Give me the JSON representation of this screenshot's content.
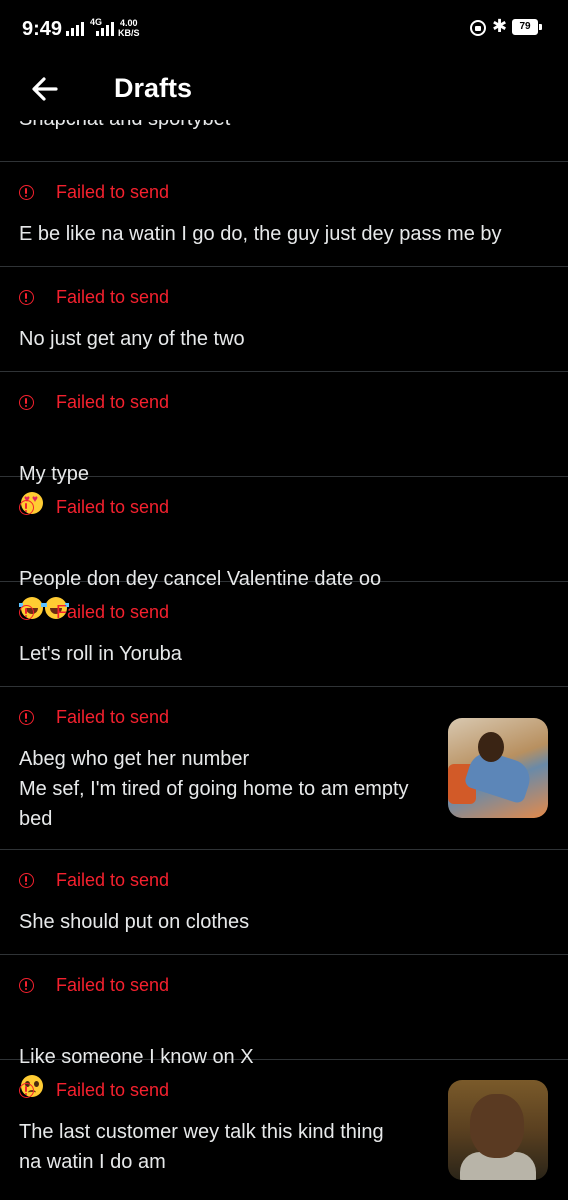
{
  "status_bar": {
    "time": "9:49",
    "network_badge": "4G",
    "net_speed_value": "4.00",
    "net_speed_unit": "KB/S",
    "battery": "79"
  },
  "header": {
    "title": "Drafts"
  },
  "partial_item_text": "Snapchat and sportybet",
  "drafts": [
    {
      "status": "Failed to send",
      "text": "E be like na watin I go do, the guy just dey pass me by"
    },
    {
      "status": "Failed to send",
      "text": "No just get any of the two"
    },
    {
      "status": "Failed to send",
      "text": "My type",
      "emoji": "heart-eyes"
    },
    {
      "status": "Failed to send",
      "text": "People don dey cancel Valentine date oo",
      "emoji": "tears-of-joy"
    },
    {
      "status": "Failed to send",
      "text": "Let's roll in Yoruba"
    },
    {
      "status": "Failed to send",
      "text": "Abeg who get her number\nMe sef, I'm tired of going home to am empty bed",
      "media": "photo-thumbnail"
    },
    {
      "status": "Failed to send",
      "text": "She should put on  clothes"
    },
    {
      "status": "Failed to send",
      "text": "Like someone I know on X",
      "emoji": "pleading-face"
    },
    {
      "status": "Failed to send",
      "text": "The last customer wey talk this kind thing\nna watin I do am",
      "media": "photo-thumbnail"
    }
  ],
  "colors": {
    "background": "#000000",
    "error": "#f4212e",
    "divider": "#2f3336",
    "text": "#e7e9ea"
  }
}
